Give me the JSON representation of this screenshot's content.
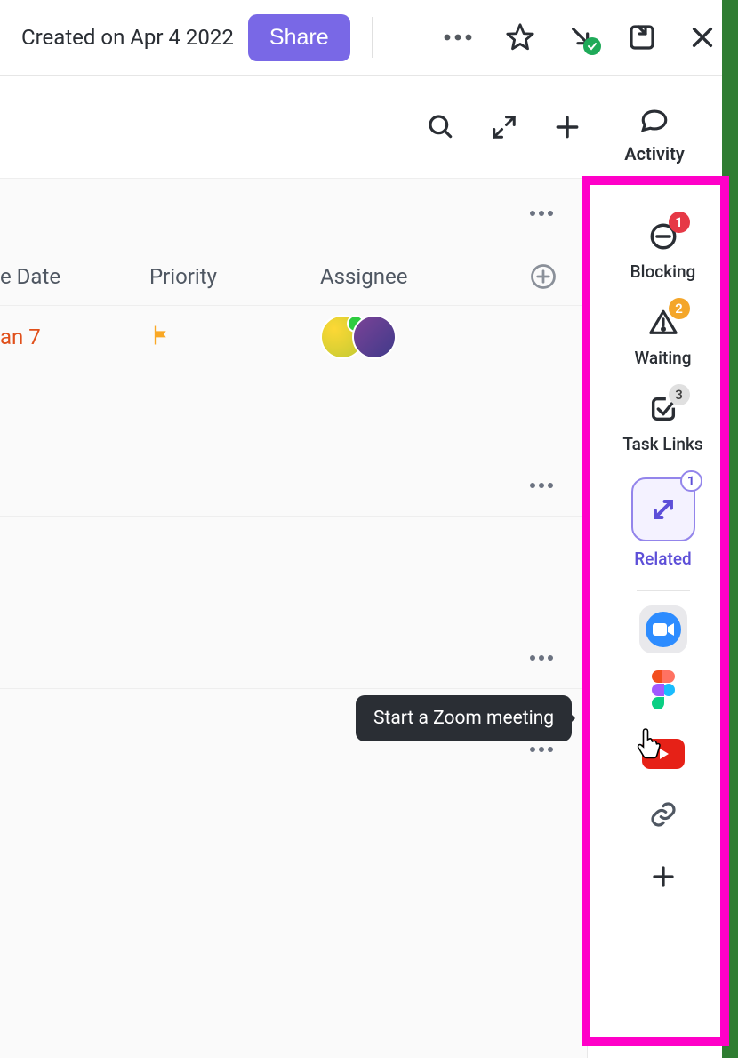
{
  "topbar": {
    "created_label": "Created on Apr 4 2022",
    "share_label": "Share"
  },
  "columns": {
    "date": "e Date",
    "priority": "Priority",
    "assignee": "Assignee"
  },
  "row": {
    "date": "an 7"
  },
  "sidebar": {
    "activity": {
      "label": "Activity"
    },
    "blocking": {
      "label": "Blocking",
      "count": "1"
    },
    "waiting": {
      "label": "Waiting",
      "count": "2"
    },
    "tasklinks": {
      "label": "Task Links",
      "count": "3"
    },
    "related": {
      "label": "Related",
      "count": "1"
    }
  },
  "tooltip": {
    "text": "Start a Zoom meeting"
  },
  "icons": {
    "more": "more-icon",
    "star": "star-icon",
    "minimize": "arrow-down-right-icon",
    "newwindow": "open-new-window-icon",
    "close": "close-icon",
    "search": "search-icon",
    "expand": "expand-icon",
    "plus": "plus-icon",
    "addcol": "plus-circle-icon",
    "flag": "flag-icon",
    "activity": "chat-bubble-icon",
    "blocking": "no-entry-icon",
    "waiting": "warning-triangle-icon",
    "tasklinks": "checkbox-checked-icon",
    "related": "swap-arrows-icon",
    "zoom": "zoom-icon",
    "figma": "figma-icon",
    "youtube": "youtube-icon",
    "link": "link-icon",
    "add": "plus-icon",
    "cursor": "pointer-cursor-icon"
  }
}
